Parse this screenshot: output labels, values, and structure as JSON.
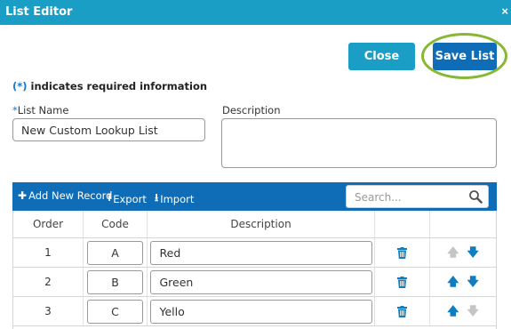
{
  "window": {
    "title": "List Editor",
    "close_glyph": "×"
  },
  "actions": {
    "close_label": "Close",
    "save_label": "Save List"
  },
  "required_note": {
    "asterisk": "(*)",
    "text": " indicates required information"
  },
  "form": {
    "name_label_asterisk": "*",
    "name_label": "List Name",
    "name_value": "New Custom Lookup List",
    "description_label": "Description",
    "description_value": ""
  },
  "toolbar": {
    "add_label": "Add New Record",
    "export_label": "Export",
    "import_label": "Import",
    "search_placeholder": "Search..."
  },
  "table": {
    "columns": [
      "Order",
      "Code",
      "Description",
      "",
      ""
    ],
    "rows": [
      {
        "order": "1",
        "code": "A",
        "description": "Red",
        "up_enabled": false,
        "down_enabled": true
      },
      {
        "order": "2",
        "code": "B",
        "description": "Green",
        "up_enabled": true,
        "down_enabled": true
      },
      {
        "order": "3",
        "code": "C",
        "description": "Yello",
        "up_enabled": true,
        "down_enabled": false
      }
    ]
  },
  "colors": {
    "titlebar": "#1a9ec5",
    "primary": "#0e6db6",
    "highlight_ring": "#86b833",
    "arrow_enabled": "#0e7ec0",
    "arrow_disabled": "#c5c5c5"
  },
  "icons": {
    "add": "plus-icon",
    "export": "upload-icon",
    "import": "download-icon",
    "search": "magnifier-icon",
    "delete": "trash-icon",
    "up": "arrow-up-icon",
    "down": "arrow-down-icon"
  }
}
